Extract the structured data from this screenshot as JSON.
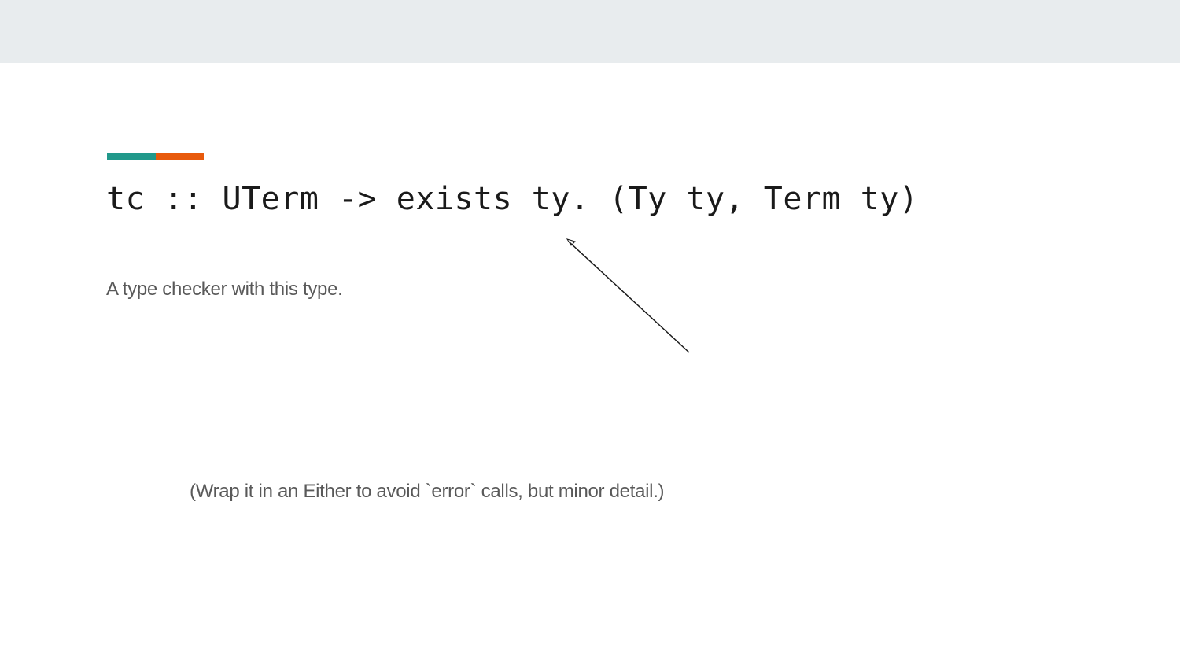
{
  "slide": {
    "title": "tc :: UTerm -> exists ty. (Ty ty, Term ty)",
    "body_text": "A type checker with this type.",
    "note_text": "(Wrap it in an Either to avoid `error` calls, but minor detail.)"
  },
  "colors": {
    "top_band": "#e8ecee",
    "accent_teal": "#21998b",
    "accent_orange": "#e85a0c",
    "title_text": "#1a1a1a",
    "body_text": "#595959",
    "arrow": "#1a1a1a"
  }
}
